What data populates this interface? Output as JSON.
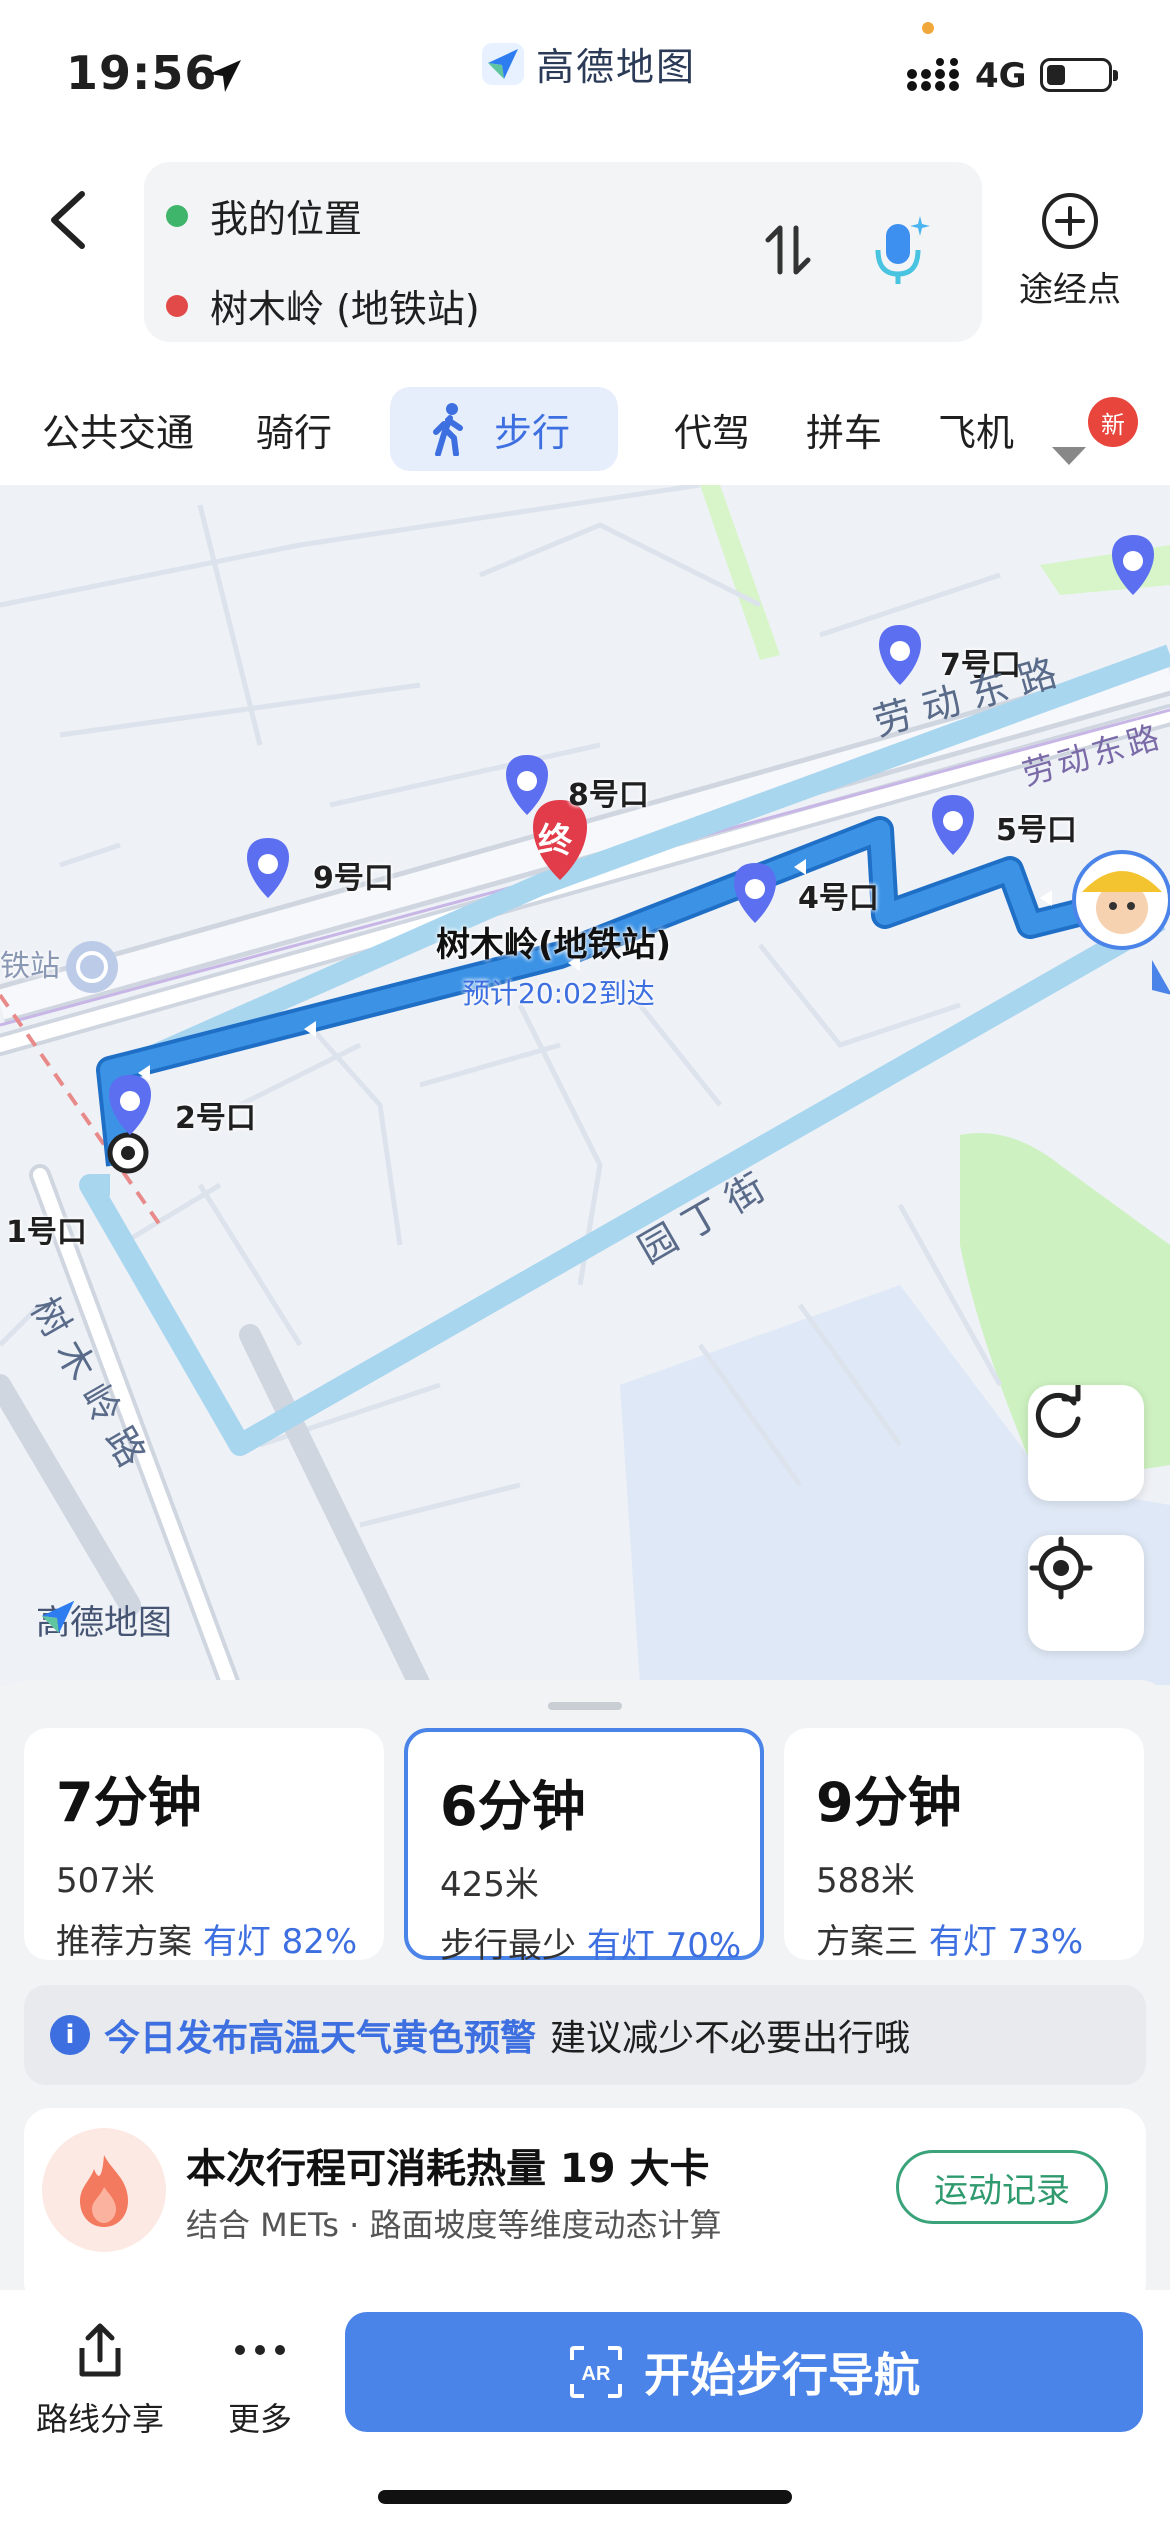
{
  "status_bar": {
    "time": "19:56",
    "app_name": "高德地图",
    "network": "4G"
  },
  "header": {
    "origin": "我的位置",
    "destination": "树木岭 (地铁站)",
    "waypoint_label": "途经点",
    "origin_color": "#3fb56b",
    "destination_color": "#e24a4a"
  },
  "tabs": {
    "items": [
      "公共交通",
      "骑行",
      "步行",
      "代驾",
      "拼车",
      "飞机"
    ],
    "active": "步行",
    "new_badge": "新"
  },
  "map": {
    "roads": [
      "劳动东路",
      "劳动东路",
      "园丁街",
      "树木岭路"
    ],
    "exits": [
      "7号口",
      "8号口",
      "9号口",
      "5号口",
      "4号口",
      "2号口",
      "1号口"
    ],
    "end_marker": "终",
    "destination_label": "树木岭(地铁站)",
    "eta": "预计20:02到达",
    "station_partial": "铁站",
    "logo": "高德地图"
  },
  "routes": [
    {
      "time": "7分钟",
      "distance": "507米",
      "tag": "推荐方案",
      "lights": "有灯 82%"
    },
    {
      "time": "6分钟",
      "distance": "425米",
      "tag": "步行最少",
      "lights": "有灯 70%"
    },
    {
      "time": "9分钟",
      "distance": "588米",
      "tag": "方案三",
      "lights": "有灯 73%"
    }
  ],
  "warning": {
    "highlight": "今日发布高温天气黄色预警",
    "text": "建议减少不必要出行哦"
  },
  "calorie": {
    "title": "本次行程可消耗热量 19 大卡",
    "subtitle": "结合 METs · 路面坡度等维度动态计算",
    "button": "运动记录"
  },
  "bottom_bar": {
    "share": "路线分享",
    "more": "更多",
    "start": "开始步行导航"
  },
  "colors": {
    "accent": "#4a84e8",
    "route": "#2f86d9",
    "route_alt": "#a8d6ef",
    "pin": "#5b6ff0",
    "end": "#e23b4a"
  }
}
